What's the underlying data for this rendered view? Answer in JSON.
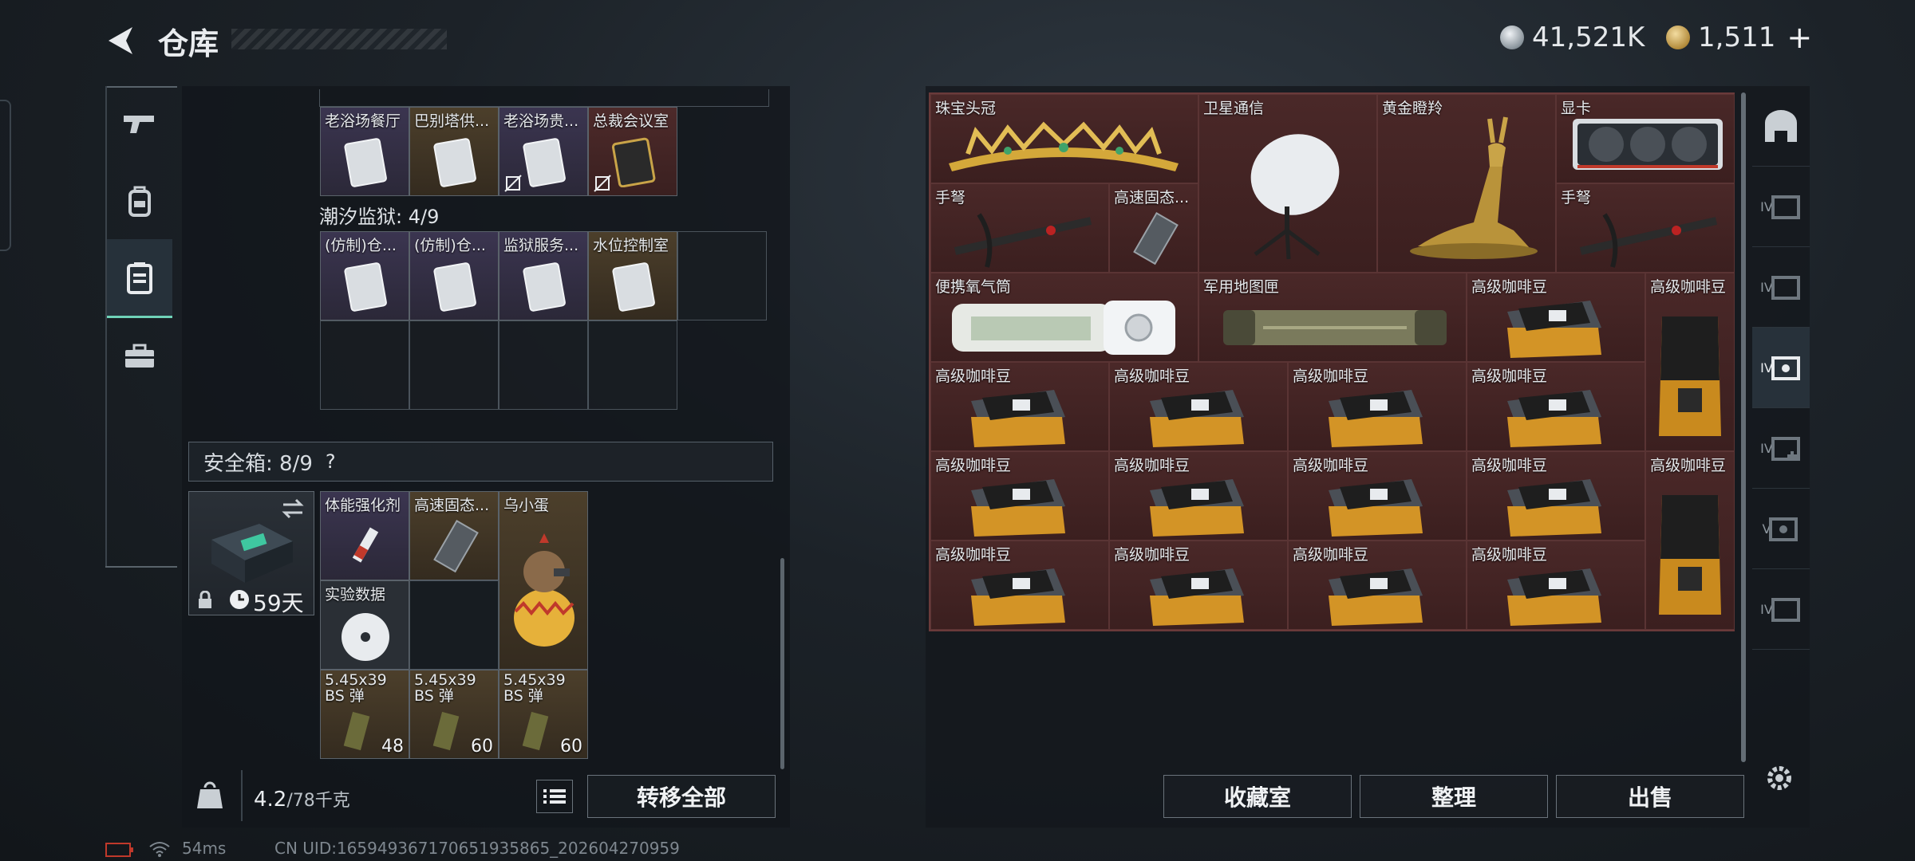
{
  "header": {
    "title": "仓库"
  },
  "currency": {
    "silver": "41,521K",
    "gold": "1,511"
  },
  "left": {
    "row_top_labels": [
      "老浴场餐厅",
      "巴别塔供...",
      "老浴场贵...",
      "总裁会议室"
    ],
    "prison_label": "潮汐监狱: 4/9",
    "prison_items": [
      "(仿制)仓...",
      "(仿制)仓...",
      "监狱服务...",
      "水位控制室"
    ],
    "safe_label": "安全箱: 8/9",
    "safe_help": "?",
    "safe_timer": "59天",
    "safe_items": {
      "a": "体能强化剂",
      "b": "高速固态...",
      "c": "乌小蛋",
      "d": "实验数据",
      "ammo1": "5.45x39 BS 弹",
      "ammo1_qty": "48",
      "ammo2": "5.45x39 BS 弹",
      "ammo2_qty": "60",
      "ammo3": "5.45x39 BS 弹",
      "ammo3_qty": "60"
    },
    "weight_current": "4.2",
    "weight_max": "/78千克",
    "transfer_all": "转移全部"
  },
  "right": {
    "items": {
      "crown": "珠宝头冠",
      "satellite": "卫星通信",
      "antelope": "黄金瞪羚",
      "gpu": "显卡",
      "crossbow1": "手弩",
      "ssd": "高速固态...",
      "crossbow2": "手弩",
      "oxygen": "便携氧气筒",
      "maptube": "军用地图匣",
      "coffee": "高级咖啡豆"
    },
    "buttons": {
      "collection": "收藏室",
      "sort": "整理",
      "sell": "出售"
    },
    "side_tabs": [
      "IV",
      "IV",
      "IV",
      "IV",
      "V",
      "IV"
    ]
  },
  "status": {
    "ping": "54ms",
    "uid": "CN UID:16594936717065193​5865_202604270959"
  }
}
